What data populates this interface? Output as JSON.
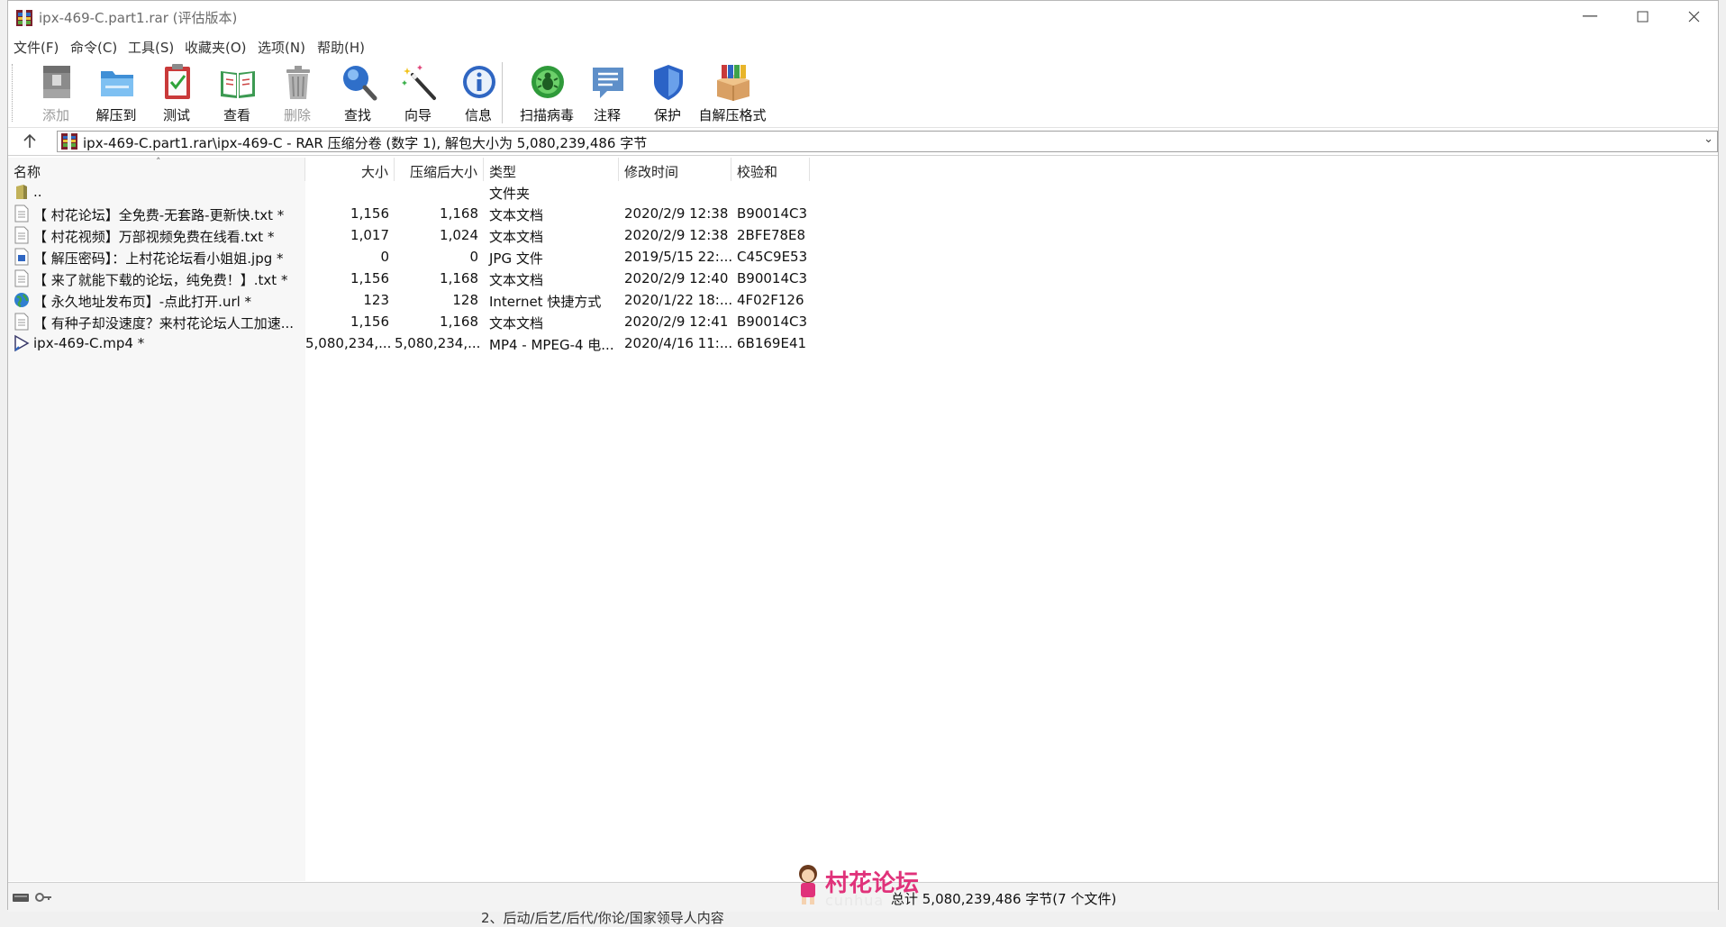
{
  "window": {
    "title": "ipx-469-C.part1.rar (评估版本)"
  },
  "menu": [
    "文件(F)",
    "命令(C)",
    "工具(S)",
    "收藏夹(O)",
    "选项(N)",
    "帮助(H)"
  ],
  "toolbar": {
    "add": "添加",
    "extract": "解压到",
    "test": "测试",
    "view": "查看",
    "delete": "删除",
    "find": "查找",
    "wizard": "向导",
    "info": "信息",
    "scan": "扫描病毒",
    "comment": "注释",
    "protect": "保护",
    "sfx": "自解压格式"
  },
  "address": {
    "path": "ipx-469-C.part1.rar\\ipx-469-C - RAR 压缩分卷 (数字 1), 解包大小为 5,080,239,486 字节"
  },
  "columns": {
    "name": "名称",
    "size": "大小",
    "packed": "压缩后大小",
    "type": "类型",
    "modified": "修改时间",
    "crc": "校验和"
  },
  "files": [
    {
      "name": "..",
      "size": "",
      "packed": "",
      "type": "文件夹",
      "modified": "",
      "crc": "",
      "icon": "folder-up-icon"
    },
    {
      "name": "【 村花论坛】全免费-无套路-更新快.txt *",
      "size": "1,156",
      "packed": "1,168",
      "type": "文本文档",
      "modified": "2020/2/9 12:38",
      "crc": "B90014C3",
      "icon": "text-file-icon"
    },
    {
      "name": "【 村花视频】万部视频免费在线看.txt *",
      "size": "1,017",
      "packed": "1,024",
      "type": "文本文档",
      "modified": "2020/2/9 12:38",
      "crc": "2BFE78E8",
      "icon": "text-file-icon"
    },
    {
      "name": "【 解压密码】：上村花论坛看小姐姐.jpg *",
      "size": "0",
      "packed": "0",
      "type": "JPG 文件",
      "modified": "2019/5/15 22:...",
      "crc": "C45C9E53",
      "icon": "image-file-icon"
    },
    {
      "name": "【 来了就能下载的论坛，纯免费！】.txt *",
      "size": "1,156",
      "packed": "1,168",
      "type": "文本文档",
      "modified": "2020/2/9 12:40",
      "crc": "B90014C3",
      "icon": "text-file-icon"
    },
    {
      "name": "【 永久地址发布页】-点此打开.url *",
      "size": "123",
      "packed": "128",
      "type": "Internet 快捷方式",
      "modified": "2020/1/22 18:...",
      "crc": "4F02F126",
      "icon": "globe-icon"
    },
    {
      "name": "【 有种子却没速度？来村花论坛人工加速...",
      "size": "1,156",
      "packed": "1,168",
      "type": "文本文档",
      "modified": "2020/2/9 12:41",
      "crc": "B90014C3",
      "icon": "text-file-icon"
    },
    {
      "name": "ipx-469-C.mp4 *",
      "size": "5,080,234,...",
      "packed": "5,080,234,...",
      "type": "MP4 - MPEG-4 电...",
      "modified": "2020/4/16 11:...",
      "crc": "6B169E41",
      "icon": "video-file-icon"
    }
  ],
  "status": {
    "total": "总计 5,080,239,486 字节(7 个文件)"
  },
  "watermark": {
    "main": "村花论坛",
    "sub": "cunhua"
  },
  "below": {
    "text": "2、后动/后艺/后代/你论/国家领导人内容"
  }
}
